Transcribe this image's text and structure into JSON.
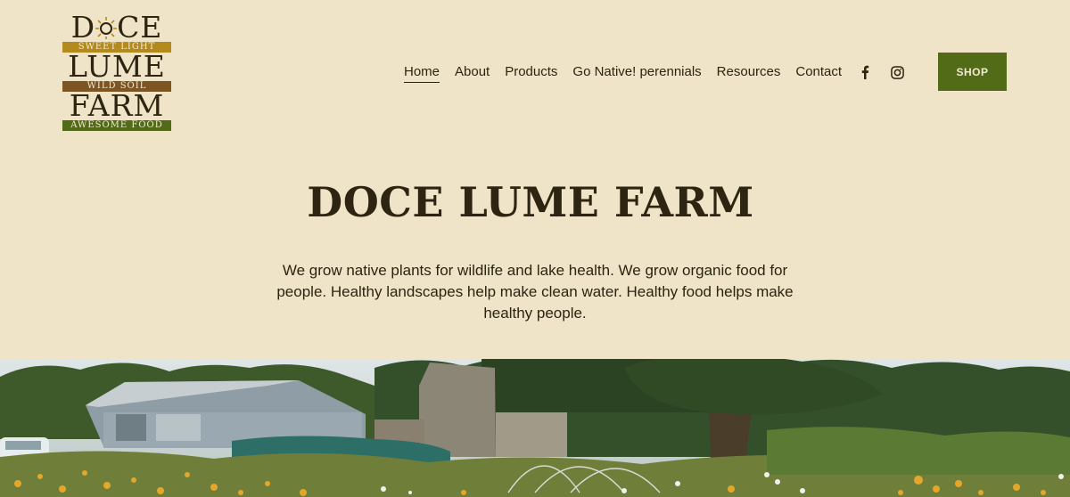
{
  "logo": {
    "line1_left": "D",
    "line1_right": "CE",
    "band1": "SWEET LIGHT",
    "line2": "LUME",
    "band2": "WILD SOIL",
    "line3": "FARM",
    "band3": "AWESOME FOOD"
  },
  "nav": {
    "items": [
      {
        "label": "Home",
        "active": true
      },
      {
        "label": "About"
      },
      {
        "label": "Products"
      },
      {
        "label": "Go Native! perennials"
      },
      {
        "label": "Resources"
      },
      {
        "label": "Contact"
      }
    ]
  },
  "social": {
    "facebook_icon": "facebook-icon",
    "instagram_icon": "instagram-icon"
  },
  "shop_button": {
    "label": "SHOP",
    "color": "#526b17"
  },
  "hero": {
    "title": "DOCE LUME FARM",
    "text": "We grow native plants for wildlife and lake health. We grow organic food for people. Healthy landscapes help make clean water. Healthy food helps make healthy people."
  },
  "colors": {
    "background": "#efe4c8",
    "accent": "#526b17",
    "text": "#2b2410"
  }
}
